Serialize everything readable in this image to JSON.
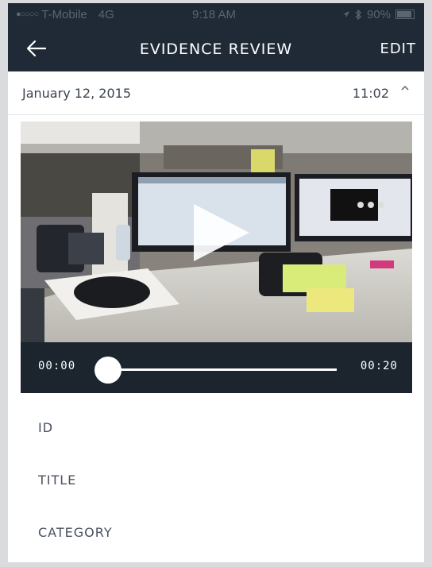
{
  "status_bar": {
    "signal_dots": "●○○○○",
    "carrier": "T-Mobile",
    "network": "4G",
    "time": "9:18 AM",
    "battery_percent_text": "90%",
    "battery_level": 0.9,
    "icons": [
      "location-icon",
      "bluetooth-icon",
      "battery-icon"
    ]
  },
  "navbar": {
    "back_icon": "arrow-left-icon",
    "title": "EVIDENCE REVIEW",
    "edit_label": "EDIT"
  },
  "date_bar": {
    "date": "January 12, 2015",
    "time": "11:02",
    "caret_icon": "caret-up-icon"
  },
  "video": {
    "play_icon": "play-icon",
    "current_time": "00:00",
    "duration": "00:20",
    "progress": 0.0
  },
  "fields": [
    {
      "label": "ID"
    },
    {
      "label": "TITLE"
    },
    {
      "label": "CATEGORY"
    }
  ],
  "colors": {
    "navbar_bg": "#1f2a36",
    "player_bg": "#1c242e",
    "text_gray": "#4a5260"
  }
}
